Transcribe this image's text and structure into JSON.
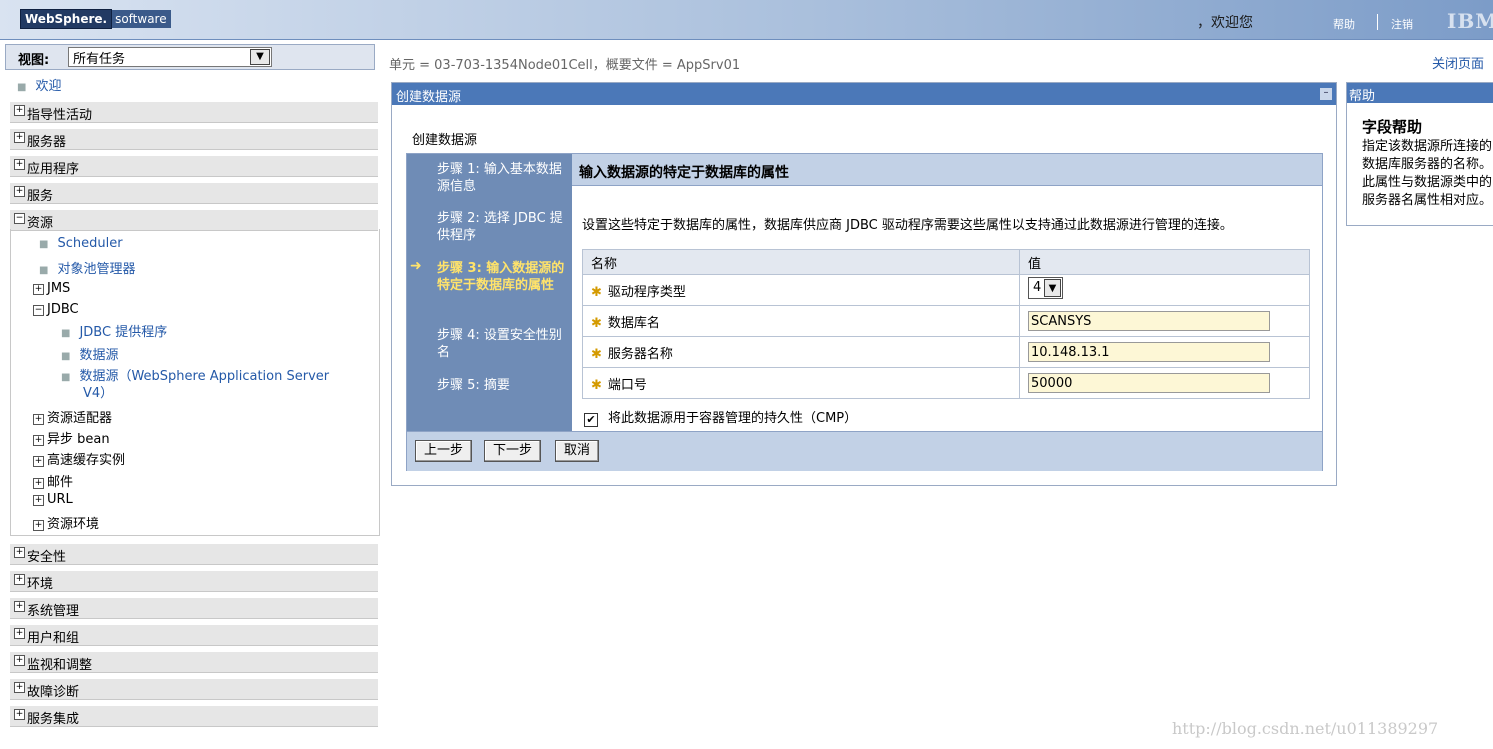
{
  "banner": {
    "brand_strong": "WebSphere.",
    "brand_light": "software",
    "welcome": "，欢迎您",
    "help": "帮助",
    "logout": "注销",
    "ibm": "IBM."
  },
  "nav": {
    "view_label": "视图:",
    "view_value": "所有任务",
    "welcome": "欢迎",
    "groups_top": [
      "指导性活动",
      "服务器",
      "应用程序",
      "服务"
    ],
    "resources": {
      "label": "资源",
      "children": {
        "scheduler": "Scheduler",
        "object_pool": "对象池管理器",
        "jms": "JMS",
        "jdbc": "JDBC",
        "jdbc_provider": "JDBC 提供程序",
        "datasource": "数据源",
        "datasource_v4_line1": "数据源（WebSphere Application Server",
        "datasource_v4_line2": "V4）",
        "adapters": "资源适配器",
        "async_bean": "异步 bean",
        "cache": "高速缓存实例",
        "mail": "邮件",
        "url": "URL",
        "env": "资源环境"
      }
    },
    "groups_bottom": [
      "安全性",
      "环境",
      "系统管理",
      "用户和组",
      "监视和调整",
      "故障诊断",
      "服务集成"
    ]
  },
  "main": {
    "breadcrumb": "单元 = 03-703-1354Node01Cell，概要文件 = AppSrv01",
    "close_page": "关闭页面",
    "panel_title": "创建数据源",
    "panel_subtitle": "创建数据源",
    "steps": [
      "步骤 1: 输入基本数据源信息",
      "步骤 2: 选择 JDBC 提供程序",
      "步骤 3: 输入数据源的特定于数据库的属性",
      "步骤 4: 设置安全性别名",
      "步骤 5: 摘要"
    ],
    "content_title": "输入数据源的特定于数据库的属性",
    "description": "设置这些特定于数据库的属性，数据库供应商 JDBC 驱动程序需要这些属性以支持通过此数据源进行管理的连接。",
    "table": {
      "col_name": "名称",
      "col_value": "值",
      "rows": [
        {
          "name": "驱动程序类型",
          "value": "4"
        },
        {
          "name": "数据库名",
          "value": "SCANSYS"
        },
        {
          "name": "服务器名称",
          "value": "10.148.13.1"
        },
        {
          "name": "端口号",
          "value": "50000"
        }
      ]
    },
    "cmp_label": "将此数据源用于容器管理的持久性（CMP）",
    "buttons": {
      "prev": "上一步",
      "next": "下一步",
      "cancel": "取消"
    }
  },
  "help": {
    "title": "帮助",
    "heading": "字段帮助",
    "text": "指定该数据源所连接的数据库服务器的名称。此属性与数据源类中的服务器名属性相对应。"
  },
  "watermark": "http://blog.csdn.net/u011389297"
}
